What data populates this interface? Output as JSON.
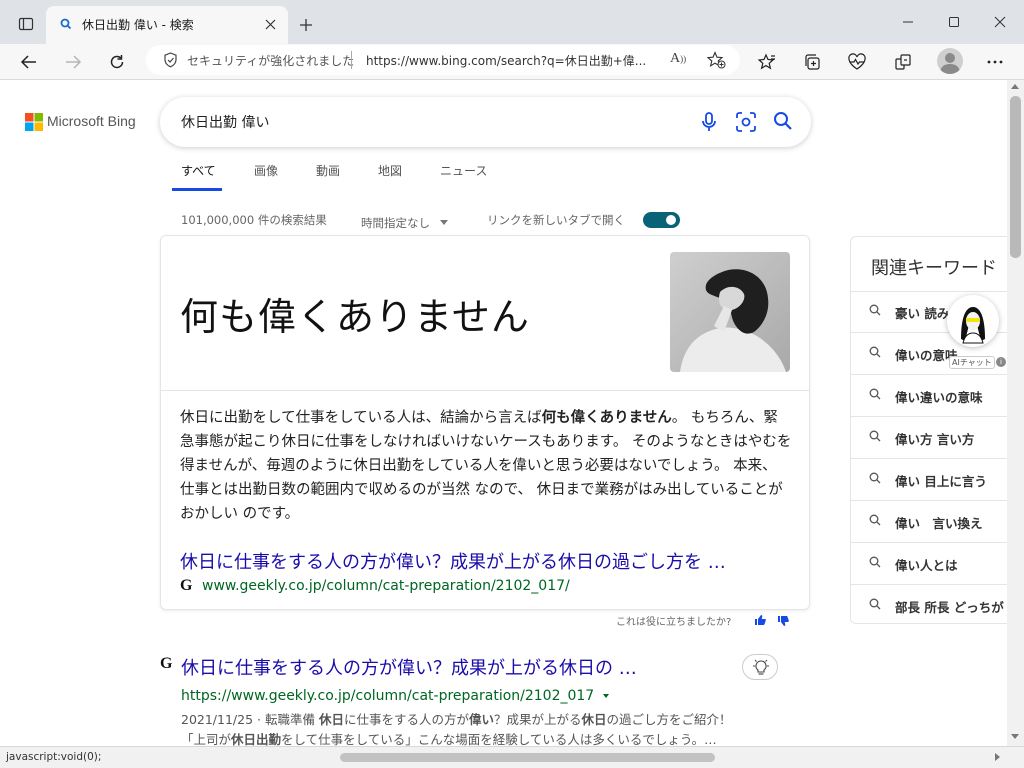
{
  "browser": {
    "tab_title": "休日出勤 偉い - 検索",
    "security_label": "セキュリティが強化されました",
    "url": "https://www.bing.com/search?q=休日出勤+偉...",
    "reader_label": "A"
  },
  "bing": {
    "logo_text": "Microsoft Bing",
    "query": "休日出勤 偉い",
    "tabs": [
      "すべて",
      "画像",
      "動画",
      "地図",
      "ニュース"
    ],
    "result_count": "101,000,000 件の検索結果",
    "time_filter": "時間指定なし",
    "new_tab_label": "リンクを新しいタブで開く"
  },
  "answer": {
    "headline": "何も偉くありません",
    "body_1": "休日に出勤をして仕事をしている人は、結論から言えば",
    "body_bold": "何も偉くありません",
    "body_2": "。 もちろん、緊急事態が起こり休日に仕事をしなければいけないケースもあります。 そのようなときはやむを得ませんが、毎週のように休日出勤をしている人を偉いと思う必要はないでしょう。 本来、 仕事とは出勤日数の範囲内で収めるのが当然 なので、 休日まで業務がはみ出していることがおかしい のです。",
    "link_title": "休日に仕事をする人の方が偉い？成果が上がる休日の過ごし方を …",
    "link_url": "www.geekly.co.jp/column/cat-preparation/2102_017/",
    "site_letter": "G",
    "feedback": "これは役に立ちましたか?"
  },
  "related": {
    "title": "関連キーワード",
    "items": [
      "豪い 読み方",
      "偉いの意味",
      "偉い違いの意味",
      "偉い方 言い方",
      "偉い 目上に言う",
      "偉い　言い換え",
      "偉い人とは",
      "部長 所長 どっちが"
    ],
    "ai_label": "AIチャット"
  },
  "result": {
    "site_letter": "G",
    "title": "休日に仕事をする人の方が偉い？成果が上がる休日の …",
    "url": "https://www.geekly.co.jp/column/cat-preparation/2102_017",
    "snippet_1_pre": "2021/11/25 · 転職準備 ",
    "snippet_1_b1": "休日",
    "snippet_1_mid": "に仕事をする人の方が",
    "snippet_1_b2": "偉い",
    "snippet_1_mid2": "？成果が上がる",
    "snippet_1_b3": "休日",
    "snippet_1_post": "の過ごし方をご紹介！",
    "snippet_2_pre": "「上司が",
    "snippet_2_b": "休日出勤",
    "snippet_2_post": "をして仕事をしている」こんな場面を経験している人は多くいるでしょう。…"
  },
  "status": {
    "text": "javascript:void(0);"
  },
  "colors": {
    "link": "#1a0dab",
    "url_green": "#006621",
    "toggle": "#0a6276",
    "tab_active": "#174ae4"
  }
}
